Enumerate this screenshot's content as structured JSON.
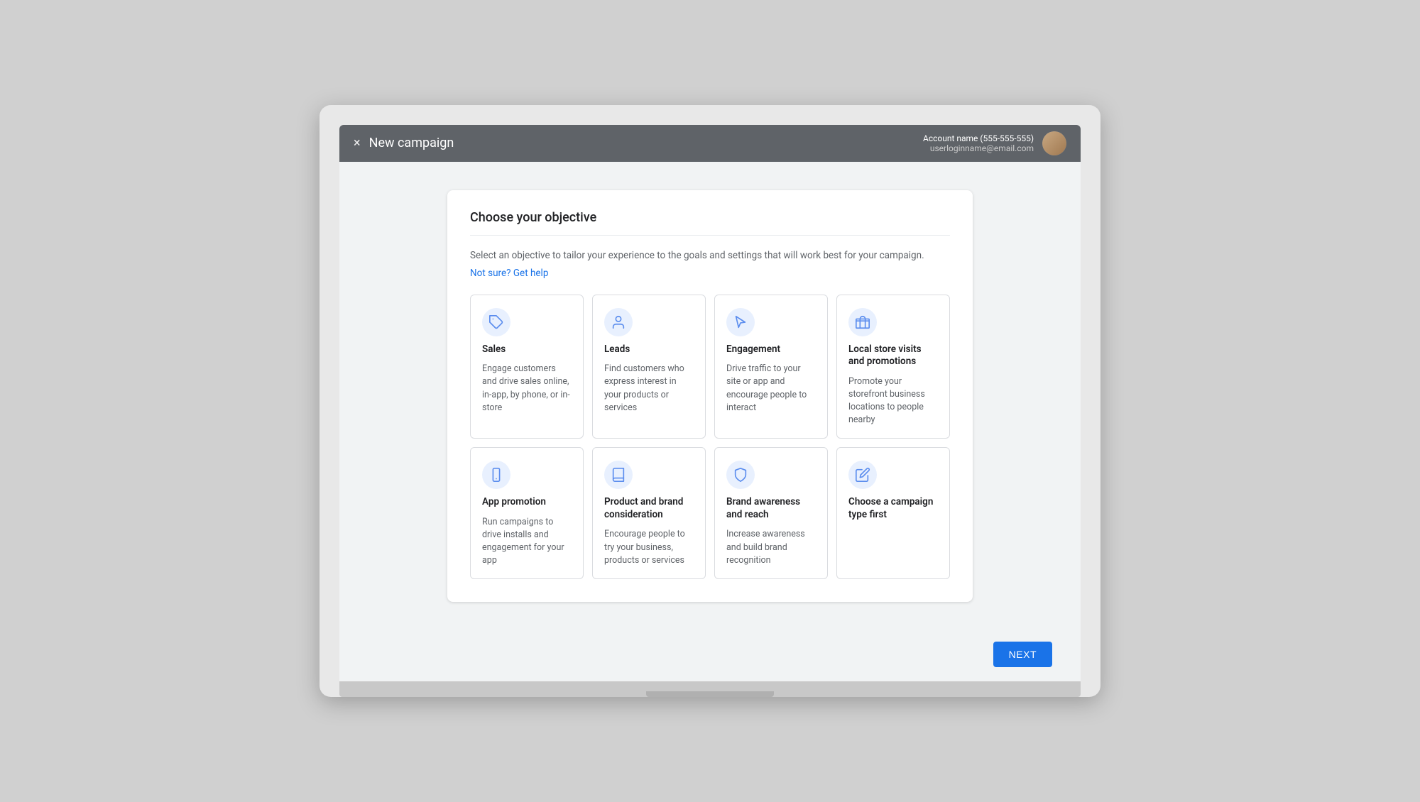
{
  "topbar": {
    "close_icon": "×",
    "title": "New campaign",
    "account_name": "Account name (555-555-555)",
    "account_email": "userloginname@email.com"
  },
  "card": {
    "title": "Choose your objective",
    "description": "Select an objective to tailor your experience to the goals and settings that will work best for your campaign.",
    "help_link": "Not sure? Get help"
  },
  "objectives": [
    {
      "id": "sales",
      "name": "Sales",
      "description": "Engage customers and drive sales online, in-app, by phone, or in-store",
      "icon": "tag"
    },
    {
      "id": "leads",
      "name": "Leads",
      "description": "Find customers who express interest in your products or services",
      "icon": "person"
    },
    {
      "id": "engagement",
      "name": "Engagement",
      "description": "Drive traffic to your site or app and encourage people to interact",
      "icon": "cursor"
    },
    {
      "id": "local",
      "name": "Local store visits and promotions",
      "description": "Promote your storefront business locations to people nearby",
      "icon": "store"
    },
    {
      "id": "app",
      "name": "App promotion",
      "description": "Run campaigns to drive installs and engagement for your app",
      "icon": "phone"
    },
    {
      "id": "product",
      "name": "Product and brand consideration",
      "description": "Encourage people to try your business, products or services",
      "icon": "book"
    },
    {
      "id": "brand",
      "name": "Brand awareness and reach",
      "description": "Increase awareness and build brand recognition",
      "icon": "shield"
    },
    {
      "id": "choose",
      "name": "Choose a campaign type first",
      "description": "",
      "icon": "pencil"
    }
  ],
  "footer": {
    "next_label": "NEXT"
  }
}
